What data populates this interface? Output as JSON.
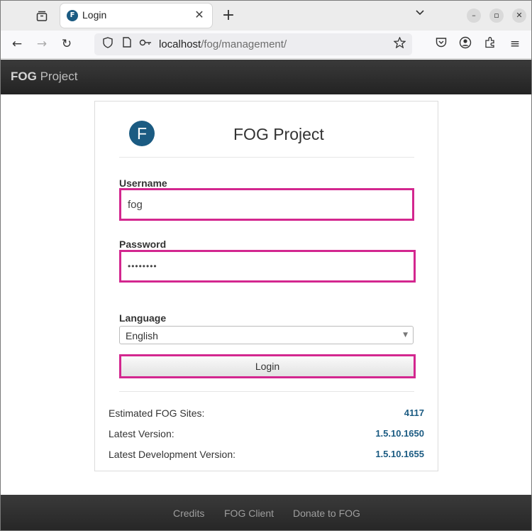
{
  "browser": {
    "tab_title": "Login",
    "tab_favicon_letter": "F",
    "url_host": "localhost",
    "url_path": "/fog/management/"
  },
  "header": {
    "brand_bold": "FOG",
    "brand_rest": " Project"
  },
  "login": {
    "logo_letter": "F",
    "title": "FOG Project",
    "username_label": "Username",
    "username_value": "fog",
    "password_label": "Password",
    "password_value": "••••••••",
    "language_label": "Language",
    "language_value": "English",
    "login_button": "Login"
  },
  "stats": [
    {
      "label": "Estimated FOG Sites:",
      "value": "4117"
    },
    {
      "label": "Latest Version:",
      "value": "1.5.10.1650"
    },
    {
      "label": "Latest Development Version:",
      "value": "1.5.10.1655"
    }
  ],
  "footer": {
    "links": [
      "Credits",
      "FOG Client",
      "Donate to FOG"
    ]
  },
  "colors": {
    "brand_blue": "#1b5b82",
    "highlight_magenta": "#d3278f",
    "header_dark": "#2d2d2d"
  }
}
